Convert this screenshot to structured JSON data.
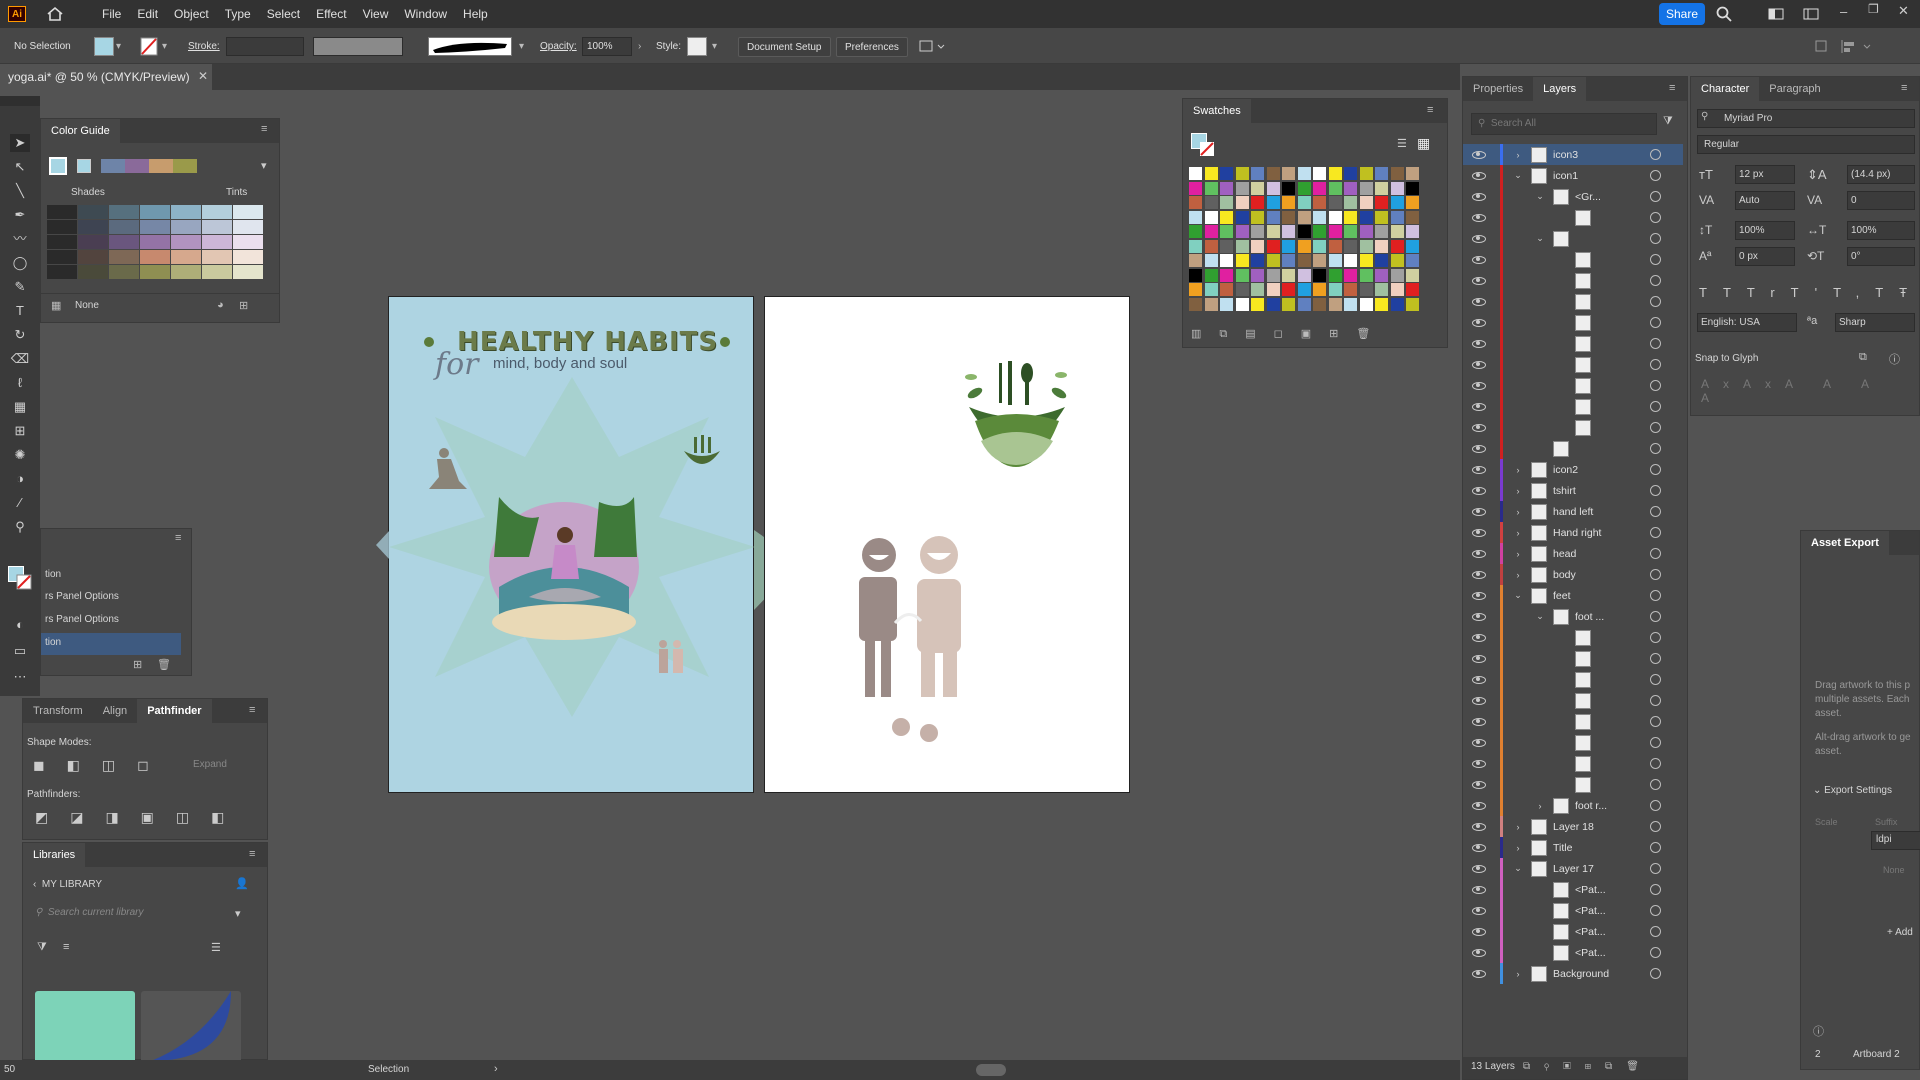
{
  "app": {
    "logo": "Ai",
    "menus": [
      "File",
      "Edit",
      "Object",
      "Type",
      "Select",
      "Effect",
      "View",
      "Window",
      "Help"
    ],
    "share": "Share"
  },
  "control": {
    "selection": "No Selection",
    "stroke_label": "Stroke:",
    "opacity_label": "Opacity:",
    "opacity_value": "100%",
    "style_label": "Style:",
    "doc_setup": "Document Setup",
    "preferences": "Preferences"
  },
  "document": {
    "tab": "yoga.ai* @ 50 % (CMYK/Preview)"
  },
  "color_guide": {
    "title": "Color Guide",
    "shades": "Shades",
    "tints": "Tints",
    "none": "None"
  },
  "mini_panel": {
    "items": [
      "tion",
      "rs Panel Options",
      "rs Panel Options",
      "tion"
    ]
  },
  "pathfinder": {
    "tabs": [
      "Transform",
      "Align",
      "Pathfinder"
    ],
    "shape_modes": "Shape Modes:",
    "expand": "Expand",
    "pathfinders": "Pathfinders:"
  },
  "libraries": {
    "title": "Libraries",
    "my_library": "MY LIBRARY",
    "search_placeholder": "Search current library",
    "swatch_colors": [
      "#7dd3b8",
      "#2d4aa0"
    ]
  },
  "poster": {
    "title": "HEALTHY HABITS",
    "script": "for",
    "subtitle": "mind, body and soul"
  },
  "swatches": {
    "title": "Swatches"
  },
  "layers_panel": {
    "tabs": [
      "Properties",
      "Layers"
    ],
    "search_placeholder": "Search All",
    "count": "13 Layers",
    "rows": [
      {
        "name": "icon3",
        "color": "#3a6ef0",
        "indent": 0,
        "exp": "›",
        "sel": true
      },
      {
        "name": "icon1",
        "color": "#d02020",
        "indent": 0,
        "exp": "⌄"
      },
      {
        "name": "<Gr...",
        "color": "#d02020",
        "indent": 1,
        "exp": "⌄"
      },
      {
        "name": "",
        "color": "#d02020",
        "indent": 2,
        "exp": ""
      },
      {
        "name": "",
        "color": "#d02020",
        "indent": 1,
        "exp": "⌄"
      },
      {
        "name": "",
        "color": "#d02020",
        "indent": 2,
        "exp": ""
      },
      {
        "name": "",
        "color": "#d02020",
        "indent": 2,
        "exp": ""
      },
      {
        "name": "",
        "color": "#d02020",
        "indent": 2,
        "exp": ""
      },
      {
        "name": "",
        "color": "#d02020",
        "indent": 2,
        "exp": ""
      },
      {
        "name": "",
        "color": "#d02020",
        "indent": 2,
        "exp": ""
      },
      {
        "name": "",
        "color": "#d02020",
        "indent": 2,
        "exp": ""
      },
      {
        "name": "",
        "color": "#d02020",
        "indent": 2,
        "exp": ""
      },
      {
        "name": "",
        "color": "#d02020",
        "indent": 2,
        "exp": ""
      },
      {
        "name": "",
        "color": "#d02020",
        "indent": 2,
        "exp": ""
      },
      {
        "name": "",
        "color": "#d02020",
        "indent": 1,
        "exp": ""
      },
      {
        "name": "icon2",
        "color": "#7a3ad0",
        "indent": 0,
        "exp": "›"
      },
      {
        "name": "tshirt",
        "color": "#7a3ad0",
        "indent": 0,
        "exp": "›"
      },
      {
        "name": "hand left",
        "color": "#2a2a8a",
        "indent": 0,
        "exp": "›"
      },
      {
        "name": "Hand right",
        "color": "#d04040",
        "indent": 0,
        "exp": "›"
      },
      {
        "name": "head",
        "color": "#d040a0",
        "indent": 0,
        "exp": "›"
      },
      {
        "name": "body",
        "color": "#c04040",
        "indent": 0,
        "exp": "›"
      },
      {
        "name": "feet",
        "color": "#e08030",
        "indent": 0,
        "exp": "⌄"
      },
      {
        "name": "foot ...",
        "color": "#e08030",
        "indent": 1,
        "exp": "⌄"
      },
      {
        "name": "",
        "color": "#e08030",
        "indent": 2,
        "exp": ""
      },
      {
        "name": "",
        "color": "#e08030",
        "indent": 2,
        "exp": ""
      },
      {
        "name": "",
        "color": "#e08030",
        "indent": 2,
        "exp": ""
      },
      {
        "name": "",
        "color": "#e08030",
        "indent": 2,
        "exp": ""
      },
      {
        "name": "",
        "color": "#e08030",
        "indent": 2,
        "exp": ""
      },
      {
        "name": "",
        "color": "#e08030",
        "indent": 2,
        "exp": ""
      },
      {
        "name": "",
        "color": "#e08030",
        "indent": 2,
        "exp": ""
      },
      {
        "name": "",
        "color": "#e08030",
        "indent": 2,
        "exp": ""
      },
      {
        "name": "foot r...",
        "color": "#e08030",
        "indent": 1,
        "exp": "›"
      },
      {
        "name": "Layer 18",
        "color": "#d08080",
        "indent": 0,
        "exp": "›"
      },
      {
        "name": "Title",
        "color": "#2a2a8a",
        "indent": 0,
        "exp": "›"
      },
      {
        "name": "Layer 17",
        "color": "#d060c0",
        "indent": 0,
        "exp": "⌄"
      },
      {
        "name": "<Pat...",
        "color": "#d060c0",
        "indent": 1,
        "exp": ""
      },
      {
        "name": "<Pat...",
        "color": "#d060c0",
        "indent": 1,
        "exp": ""
      },
      {
        "name": "<Pat...",
        "color": "#d060c0",
        "indent": 1,
        "exp": ""
      },
      {
        "name": "<Pat...",
        "color": "#d060c0",
        "indent": 1,
        "exp": ""
      },
      {
        "name": "Background",
        "color": "#4090e0",
        "indent": 0,
        "exp": "›"
      }
    ]
  },
  "character": {
    "tabs": [
      "Character",
      "Paragraph"
    ],
    "font": "Myriad Pro",
    "style": "Regular",
    "size": "12 px",
    "leading": "(14.4 px)",
    "kerning": "Auto",
    "tracking": "0",
    "vscale": "100%",
    "hscale": "100%",
    "baseline": "0 px",
    "rotation": "0°",
    "language": "English: USA",
    "aa": "Sharp",
    "snap": "Snap to Glyph"
  },
  "asset_export": {
    "title": "Asset Export",
    "hint1": "Drag artwork to this p multiple assets. Each asset.",
    "hint2": "Alt-drag artwork to ge asset.",
    "export_settings": "Export Settings",
    "scale": "Scale",
    "suffix": "Suffix",
    "dpi": "ldpi",
    "none": "None",
    "add": "Add",
    "artboard_num": "2",
    "artboard_name": "Artboard 2"
  },
  "status": {
    "zoom": "50",
    "tool": "Selection"
  }
}
